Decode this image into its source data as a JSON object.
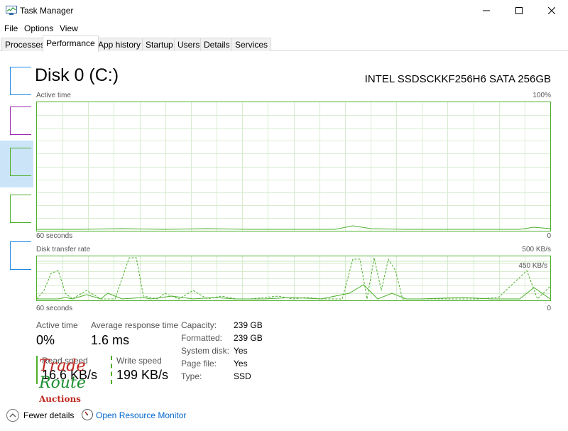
{
  "window": {
    "title": "Task Manager",
    "minimize_icon": "minimize-icon",
    "maximize_icon": "maximize-icon",
    "close_icon": "close-icon"
  },
  "menu": [
    "File",
    "Options",
    "View"
  ],
  "tabs": [
    "Processes",
    "Performance",
    "App history",
    "Startup",
    "Users",
    "Details",
    "Services"
  ],
  "active_tab": "Performance",
  "colors": {
    "disk_green": "#4caf2a",
    "link_blue": "#0066cc",
    "sidebar_selected": "#cce4f7",
    "cpu_blue": "#1e88e5",
    "memory_purple": "#9c27b0"
  },
  "disk": {
    "title": "Disk 0 (C:)",
    "model": "INTEL SSDSCKKF256H6 SATA 256GB"
  },
  "active_time_graph": {
    "label": "Active time",
    "max_label": "100%",
    "time_label": "60 seconds",
    "min_label": "0"
  },
  "transfer_graph": {
    "label": "Disk transfer rate",
    "max_label": "500 KB/s",
    "secondary_label": "450 KB/s",
    "time_label": "60 seconds",
    "min_label": "0"
  },
  "stats": {
    "active_time_label": "Active time",
    "active_time_value": "0%",
    "response_label": "Average response time",
    "response_value": "1.6 ms",
    "read_label": "Read speed",
    "read_value": "16.6 KB/s",
    "write_label": "Write speed",
    "write_value": "199 KB/s"
  },
  "properties": [
    {
      "key": "Capacity:",
      "value": "239 GB"
    },
    {
      "key": "Formatted:",
      "value": "239 GB"
    },
    {
      "key": "System disk:",
      "value": "Yes"
    },
    {
      "key": "Page file:",
      "value": "Yes"
    },
    {
      "key": "Type:",
      "value": "SSD"
    }
  ],
  "watermark": {
    "line1": "Trade",
    "line2": "Route",
    "line3": "Auctions"
  },
  "footer": {
    "fewer_details": "Fewer details",
    "resource_monitor": "Open Resource Monitor"
  }
}
